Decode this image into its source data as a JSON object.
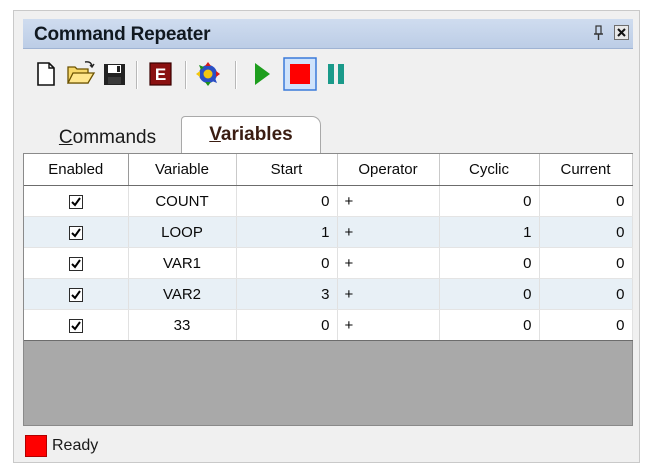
{
  "window": {
    "title": "Command Repeater"
  },
  "toolbar": {
    "buttons": [
      {
        "name": "new-icon"
      },
      {
        "name": "open-folder-icon"
      },
      {
        "name": "save-icon"
      },
      {
        "name": "edit-e-icon"
      },
      {
        "name": "settings-icon"
      },
      {
        "name": "play-icon"
      },
      {
        "name": "stop-icon"
      },
      {
        "name": "pause-icon"
      }
    ]
  },
  "tabs": [
    {
      "label": "Commands",
      "active": false
    },
    {
      "label": "Variables",
      "active": true
    }
  ],
  "table": {
    "columns": [
      "Enabled",
      "Variable",
      "Start",
      "Operator",
      "Cyclic",
      "Current"
    ],
    "rows": [
      {
        "enabled": true,
        "variable": "COUNT",
        "start": "0",
        "operator": "+",
        "cyclic": "0",
        "current": "0"
      },
      {
        "enabled": true,
        "variable": "LOOP",
        "start": "1",
        "operator": "+",
        "cyclic": "1",
        "current": "0"
      },
      {
        "enabled": true,
        "variable": "VAR1",
        "start": "0",
        "operator": "+",
        "cyclic": "0",
        "current": "0"
      },
      {
        "enabled": true,
        "variable": "VAR2",
        "start": "3",
        "operator": "+",
        "cyclic": "0",
        "current": "0"
      },
      {
        "enabled": true,
        "variable": "33",
        "start": "0",
        "operator": "+",
        "cyclic": "0",
        "current": "0"
      }
    ]
  },
  "status": {
    "text": "Ready",
    "indicator_color": "#ff0000"
  },
  "colors": {
    "play": "#1e9e1e",
    "stop": "#ff0000",
    "pause": "#1a9a8a",
    "row_alt": "#e8f0f6"
  }
}
